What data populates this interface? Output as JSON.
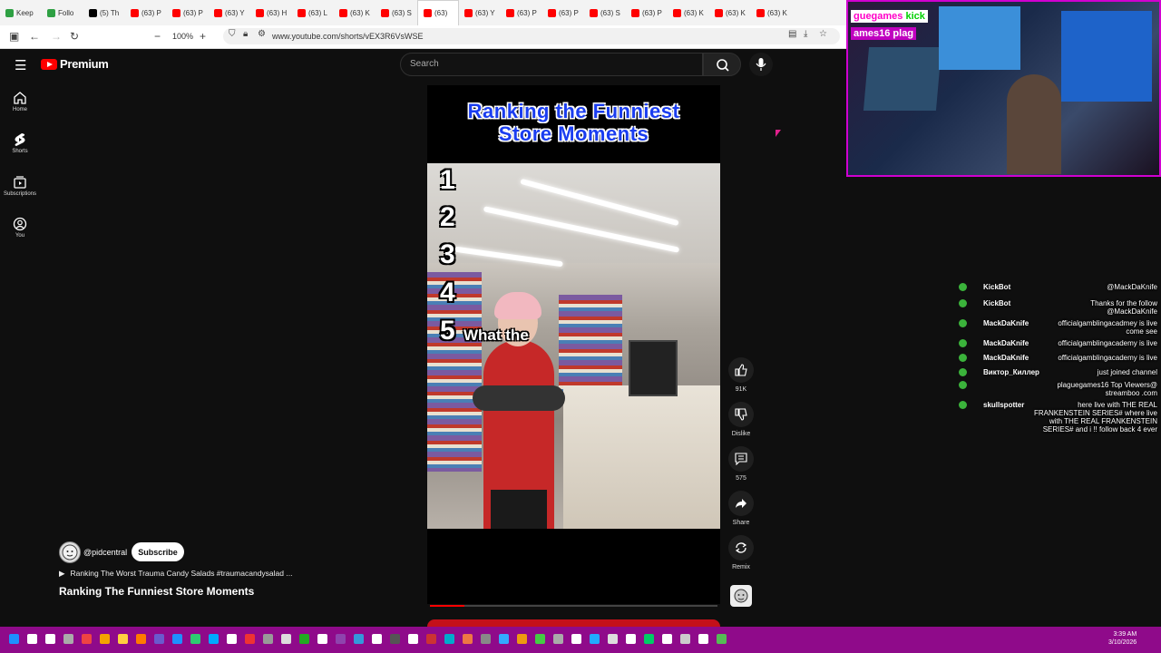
{
  "browser": {
    "tabs": [
      {
        "label": "Keep",
        "icon": "keep-icon"
      },
      {
        "label": "Follo",
        "icon": "green-icon"
      },
      {
        "label": "(5) Th",
        "icon": "x-icon"
      },
      {
        "label": "(63) P",
        "icon": "youtube-icon"
      },
      {
        "label": "(63) P",
        "icon": "youtube-icon"
      },
      {
        "label": "(63) Y",
        "icon": "youtube-icon"
      },
      {
        "label": "(63) H",
        "icon": "youtube-icon"
      },
      {
        "label": "(63) L",
        "icon": "youtube-icon"
      },
      {
        "label": "(63) K",
        "icon": "youtube-icon"
      },
      {
        "label": "(63) S",
        "icon": "youtube-icon"
      },
      {
        "label": "(63)",
        "icon": "youtube-icon"
      },
      {
        "label": "(63) Y",
        "icon": "youtube-icon"
      },
      {
        "label": "(63) P",
        "icon": "youtube-icon"
      },
      {
        "label": "(63) P",
        "icon": "youtube-icon"
      },
      {
        "label": "(63) S",
        "icon": "youtube-icon"
      },
      {
        "label": "(63) P",
        "icon": "youtube-icon"
      },
      {
        "label": "(63) K",
        "icon": "youtube-icon"
      },
      {
        "label": "(63) K",
        "icon": "youtube-icon"
      },
      {
        "label": "(63) K",
        "icon": "youtube-icon"
      }
    ],
    "zoom": "100%",
    "url": "www.youtube.com/shorts/vEX3R6VsWSE"
  },
  "youtube": {
    "logo_text": "Premium",
    "search_placeholder": "Search",
    "sidebar": [
      {
        "label": "Home",
        "icon": "home-icon"
      },
      {
        "label": "Shorts",
        "icon": "shorts-icon"
      },
      {
        "label": "Subscriptions",
        "icon": "subscriptions-icon"
      },
      {
        "label": "You",
        "icon": "you-icon"
      }
    ]
  },
  "video": {
    "overlay_title_line1": "Ranking the Funniest",
    "overlay_title_line2": "Store Moments",
    "rank_numbers": [
      "1",
      "2",
      "3",
      "4",
      "5"
    ],
    "caption": "What the",
    "progress": 0.12
  },
  "actions": {
    "like_count": "91K",
    "dislike_label": "Dislike",
    "comment_count": "575",
    "share_label": "Share",
    "remix_label": "Remix"
  },
  "info": {
    "channel": "@pidcentral",
    "subscribe_label": "Subscribe",
    "playlist": "Ranking The Worst Trauma Candy Salads #traumacandysalad ...",
    "title": "Ranking The Funniest Store Moments"
  },
  "stream_overlay": {
    "badge_kick_name": "guegames",
    "badge_kick_word": "kick",
    "badge_yt_name": "ames16 plag"
  },
  "chat": [
    {
      "user": "KickBot",
      "message": "@MackDaKnife"
    },
    {
      "user": "KickBot",
      "message": "Thanks for the follow @MackDaKnife"
    },
    {
      "user": "MackDaKnife",
      "message": "officialgamblingacadmey is live come see"
    },
    {
      "user": "MackDaKnife",
      "message": "officialgamblingacademy is live"
    },
    {
      "user": "MackDaKnife",
      "message": "officialgamblingacademy is live"
    },
    {
      "user": "Виктор_Киллер",
      "message": "just joined channel"
    },
    {
      "user": "",
      "message": "plaguegames16 Top Viewers@ streamboo .com"
    },
    {
      "user": "skullspotter",
      "message": "here live with THE REAL FRANKENSTEIN SERIES# where live with THE REAL FRANKENSTEIN SERIES# and i !! follow back 4 ever"
    }
  ],
  "taskbar": {
    "time": "3:39 AM",
    "date": "3/10/2026"
  }
}
